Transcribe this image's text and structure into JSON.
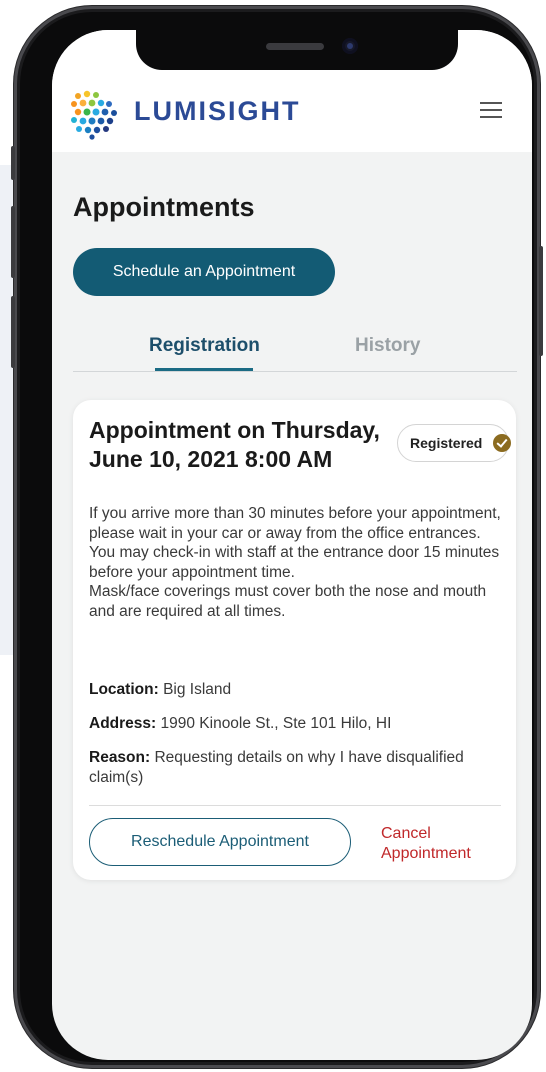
{
  "app": {
    "brand": "LUMISIGHT"
  },
  "page": {
    "title": "Appointments",
    "schedule_button": "Schedule an Appointment"
  },
  "tabs": [
    {
      "label": "Registration",
      "active": true
    },
    {
      "label": "History",
      "active": false
    }
  ],
  "appointment": {
    "title": "Appointment on Thursday, June 10, 2021 8:00 AM",
    "status": "Registered",
    "notice_lines": [
      "If you arrive more than 30 minutes before your appointment, please wait in your car or away from the office entrances.",
      "You may check-in with staff at the entrance door 15 minutes before your appointment time.",
      "Mask/face coverings must cover both the nose and mouth and are required at all times."
    ],
    "location_label": "Location:",
    "location": "Big Island",
    "address_label": "Address:",
    "address": "1990 Kinoole St., Ste 101 Hilo, HI",
    "reason_label": "Reason:",
    "reason": "Requesting details on why I have disqualified claim(s)",
    "reschedule_button": "Reschedule Appointment",
    "cancel_link": "Cancel Appointment"
  },
  "colors": {
    "brand": "#2b4a96",
    "primary": "#135b74",
    "active_tab": "#1d4f6b",
    "cancel": "#c0282a",
    "status_check": "#8b6b20"
  },
  "icons": {
    "logo": "lumisight-dots-logo",
    "menu": "hamburger-menu-icon",
    "status": "check-circle-icon"
  }
}
